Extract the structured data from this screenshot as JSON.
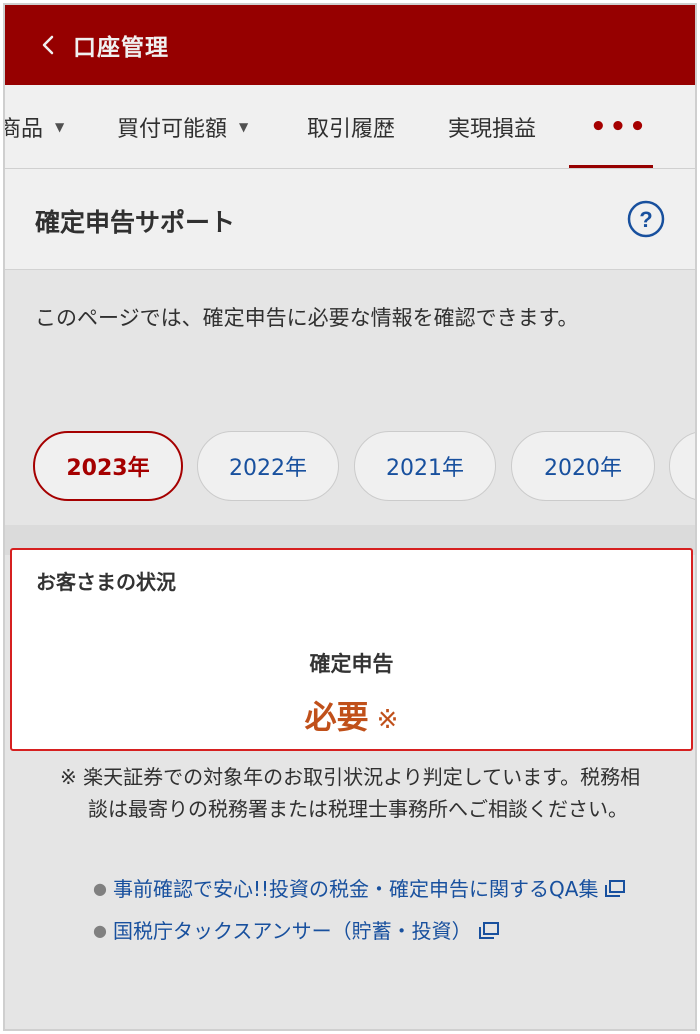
{
  "header": {
    "title": "口座管理"
  },
  "tabs": [
    {
      "label": "商品",
      "caret": "▼"
    },
    {
      "label": "買付可能額",
      "caret": "▼"
    },
    {
      "label": "取引履歴"
    },
    {
      "label": "実現損益"
    },
    {
      "label": "•••"
    }
  ],
  "section": {
    "title": "確定申告サポート",
    "intro": "このページでは、確定申告に必要な情報を確認できます。"
  },
  "years": [
    "2023年",
    "2022年",
    "2021年",
    "2020年"
  ],
  "status": {
    "heading": "お客さまの状況",
    "label": "確定申告",
    "value": "必要",
    "mark": "※"
  },
  "note": "※ 楽天証券での対象年のお取引状況より判定しています。税務相談は最寄りの税務署または税理士事務所へご相談ください。",
  "links": [
    {
      "label": "事前確認で安心!!投資の税金・確定申告に関するQA集"
    },
    {
      "label": "国税庁タックスアンサー（貯蓄・投資）"
    }
  ],
  "colors": {
    "header_bg": "#a00000",
    "accent_red": "#b00000",
    "link_blue": "#1a56a8",
    "status_orange": "#c0501a",
    "highlight_border": "#d62020"
  }
}
